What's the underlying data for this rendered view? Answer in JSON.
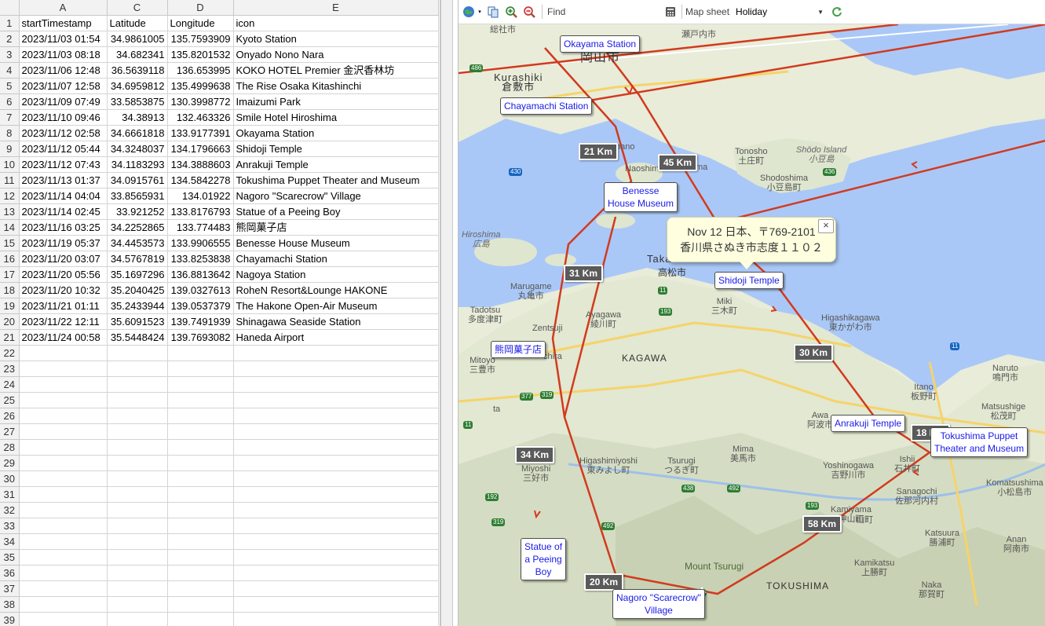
{
  "sheet": {
    "column_headers": [
      "A",
      "C",
      "D",
      "E"
    ],
    "rows": [
      {
        "n": "1",
        "a": "startTimestamp",
        "c": "Latitude",
        "d": "Longitude",
        "e": "icon",
        "header": true
      },
      {
        "n": "2",
        "a": "2023/11/03 01:54",
        "c": "34.9861005",
        "d": "135.7593909",
        "e": "Kyoto Station"
      },
      {
        "n": "3",
        "a": "2023/11/03 08:18",
        "c": "34.682341",
        "d": "135.8201532",
        "e": "Onyado Nono Nara"
      },
      {
        "n": "4",
        "a": "2023/11/06 12:48",
        "c": "36.5639118",
        "d": "136.653995",
        "e": "KOKO HOTEL Premier 金沢香林坊"
      },
      {
        "n": "5",
        "a": "2023/11/07 12:58",
        "c": "34.6959812",
        "d": "135.4999638",
        "e": "The Rise Osaka Kitashinchi"
      },
      {
        "n": "6",
        "a": "2023/11/09 07:49",
        "c": "33.5853875",
        "d": "130.3998772",
        "e": "Imaizumi Park"
      },
      {
        "n": "7",
        "a": "2023/11/10 09:46",
        "c": "34.38913",
        "d": "132.463326",
        "e": "Smile Hotel Hiroshima"
      },
      {
        "n": "8",
        "a": "2023/11/12 02:58",
        "c": "34.6661818",
        "d": "133.9177391",
        "e": "Okayama Station"
      },
      {
        "n": "9",
        "a": "2023/11/12 05:44",
        "c": "34.3248037",
        "d": "134.1796663",
        "e": "Shidoji Temple"
      },
      {
        "n": "10",
        "a": "2023/11/12 07:43",
        "c": "34.1183293",
        "d": "134.3888603",
        "e": "Anrakuji Temple"
      },
      {
        "n": "11",
        "a": "2023/11/13 01:37",
        "c": "34.0915761",
        "d": "134.5842278",
        "e": "Tokushima Puppet Theater and Museum"
      },
      {
        "n": "12",
        "a": "2023/11/14 04:04",
        "c": "33.8565931",
        "d": "134.01922",
        "e": "Nagoro \"Scarecrow\" Village"
      },
      {
        "n": "13",
        "a": "2023/11/14 02:45",
        "c": "33.921252",
        "d": "133.8176793",
        "e": "Statue of a Peeing Boy"
      },
      {
        "n": "14",
        "a": "2023/11/16 03:25",
        "c": "34.2252865",
        "d": "133.774483",
        "e": "熊岡菓子店"
      },
      {
        "n": "15",
        "a": "2023/11/19 05:37",
        "c": "34.4453573",
        "d": "133.9906555",
        "e": "Benesse House Museum"
      },
      {
        "n": "16",
        "a": "2023/11/20 03:07",
        "c": "34.5767819",
        "d": "133.8253838",
        "e": "Chayamachi Station"
      },
      {
        "n": "17",
        "a": "2023/11/20 05:56",
        "c": "35.1697296",
        "d": "136.8813642",
        "e": "Nagoya Station"
      },
      {
        "n": "18",
        "a": "2023/11/20 10:32",
        "c": "35.2040425",
        "d": "139.0327613",
        "e": "RoheN Resort&Lounge HAKONE"
      },
      {
        "n": "19",
        "a": "2023/11/21 01:11",
        "c": "35.2433944",
        "d": "139.0537379",
        "e": "The Hakone Open-Air Museum"
      },
      {
        "n": "20",
        "a": "2023/11/22 12:11",
        "c": "35.6091523",
        "d": "139.7491939",
        "e": "Shinagawa Seaside Station"
      },
      {
        "n": "21",
        "a": "2023/11/24 00:58",
        "c": "35.5448424",
        "d": "139.7693082",
        "e": "Haneda Airport"
      },
      {
        "n": "22"
      },
      {
        "n": "23"
      },
      {
        "n": "24"
      },
      {
        "n": "25"
      },
      {
        "n": "26"
      },
      {
        "n": "27"
      },
      {
        "n": "28"
      },
      {
        "n": "29"
      },
      {
        "n": "30"
      },
      {
        "n": "31"
      },
      {
        "n": "32"
      },
      {
        "n": "33"
      },
      {
        "n": "34"
      },
      {
        "n": "35"
      },
      {
        "n": "36"
      },
      {
        "n": "37"
      },
      {
        "n": "38"
      },
      {
        "n": "39"
      }
    ]
  },
  "toolbar": {
    "find_label": "Find",
    "mapsheet_label": "Map sheet",
    "mapsheet_value": "Holiday",
    "icons": [
      "globe-icon",
      "copy-icon",
      "zoom-in-icon",
      "zoom-out-icon",
      "calculator-icon",
      "refresh-icon"
    ]
  },
  "map": {
    "places": {
      "okayama": "Okayama Station",
      "chayamachi": "Chayamachi Station",
      "benesse": "Benesse\nHouse Museum",
      "shidoji": "Shidoji Temple",
      "kumaoka": "熊岡菓子店",
      "anrakuji": "Anrakuji Temple",
      "tokushima": "Tokushima Puppet\nTheater and Museum",
      "statue": "Statue of\na Peeing\nBoy",
      "nagoro": "Nagoro \"Scarecrow\"\nVillage"
    },
    "distances": {
      "d21": "21 Km",
      "d45": "45 Km",
      "d31": "31 Km",
      "d30": "30 Km",
      "d18": "18 Km",
      "d34": "34 Km",
      "d58": "58 Km",
      "d20": "20 Km"
    },
    "popup": {
      "line1": "Nov 12 日本、〒769-2101",
      "line2": "香川県さぬき市志度１１０２",
      "close": "×"
    },
    "labels": {
      "kurashiki": "Kurashiki\n倉敷市",
      "okayama_city": "岡山市",
      "soja": "総社市",
      "setouchi": "瀬戸内市",
      "tonosho": "Tonosho\n土庄町",
      "shodo": "Shōdo Island\n小豆島",
      "shodoshima": "Shodoshima\n小豆島町",
      "naoshima": "Naoshima",
      "hiroshima": "Hiroshima\n広島",
      "takamatsu": "高松市",
      "taka": "Taka",
      "marugame": "Marugame\n丸亀市",
      "tadotsu": "Tadotsu\n多度津町",
      "ayagawa": "Ayagawa\n綾川町",
      "miki": "Miki\n三木町",
      "higashikagawa": "Higashikagawa\n東かがわ市",
      "kagawa": "KAGAWA",
      "zentsuji": "Zentsuji",
      "mitoyo": "Mitoyo\n三豊市",
      "naruto": "Naruto\n鳴門市",
      "itano": "Itano\n板野町",
      "awa": "Awa\n阿波市",
      "matsushige": "Matsushige\n松茂町",
      "higashimiyoshi": "Higashimiyoshi\n東みよし町",
      "tsurugi": "Tsurugi\nつるぎ町",
      "mima": "Mima\n美馬市",
      "yoshinogawa": "Yoshinogawa\n吉野川市",
      "ishii": "Ishii\n石井町",
      "miyoshi": "Miyoshi\n三好市",
      "kamiyama": "Kamiyama\n神山町",
      "sanagochi": "Sanagochi\n佐那河内村",
      "komatsushima": "Komatsushima\n小松島市",
      "katsuura": "Katsuura\n勝浦町",
      "kamikatsu": "Kamikatsu\n上勝町",
      "anan": "Anan\n阿南市",
      "naka": "Naka\n那賀町",
      "mount_tsurugi": "Mount Tsurugi",
      "tokushima_pref": "TOKUSHIMA",
      "ta": "ta",
      "ma": "ma",
      "nano": "nano",
      "chira": "chira",
      "ji": "ji",
      "yama": "山町"
    },
    "route_color": "#d23a1e",
    "water_color": "#aac8f7",
    "land_color": "#e8ecd9"
  }
}
